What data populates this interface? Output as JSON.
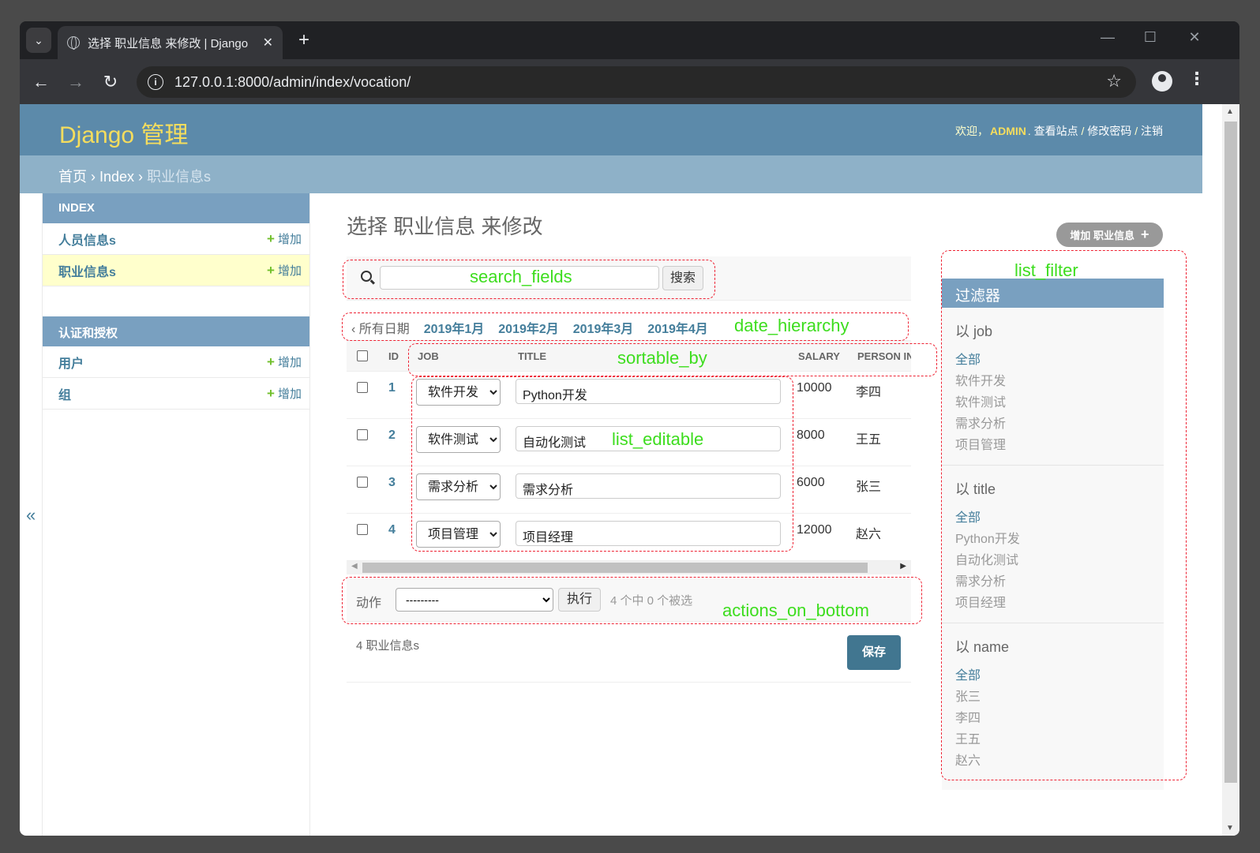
{
  "browser": {
    "tab_title": "选择 职业信息 来修改 | Django",
    "url": "127.0.0.1:8000/admin/index/vocation/"
  },
  "header": {
    "brand": "Django 管理",
    "welcome": "欢迎，",
    "username": "ADMIN",
    "view_site": "查看站点",
    "change_password": "修改密码",
    "logout": "注销"
  },
  "breadcrumbs": {
    "home": "首页",
    "app": "Index",
    "current": "职业信息s"
  },
  "sidebar": {
    "collapse_label": "«",
    "modules": [
      {
        "caption": "INDEX",
        "items": [
          {
            "name": "人员信息s",
            "add": "增加",
            "selected": false
          },
          {
            "name": "职业信息s",
            "add": "增加",
            "selected": true
          }
        ]
      },
      {
        "caption": "认证和授权",
        "items": [
          {
            "name": "用户",
            "add": "增加",
            "selected": false
          },
          {
            "name": "组",
            "add": "增加",
            "selected": false
          }
        ]
      }
    ]
  },
  "main": {
    "title": "选择 职业信息 来修改",
    "add_button": "增加 职业信息",
    "search": {
      "button": "搜索",
      "value": ""
    },
    "date_hierarchy": {
      "all": "‹ 所有日期",
      "dates": [
        "2019年1月",
        "2019年2月",
        "2019年3月",
        "2019年4月"
      ]
    },
    "table": {
      "headers": [
        "ID",
        "JOB",
        "TITLE",
        "SALARY",
        "PERSON IN"
      ],
      "rows": [
        {
          "id": "1",
          "job": "软件开发",
          "title": "Python开发",
          "salary": "10000",
          "person": "李四"
        },
        {
          "id": "2",
          "job": "软件测试",
          "title": "自动化测试",
          "salary": "8000",
          "person": "王五"
        },
        {
          "id": "3",
          "job": "需求分析",
          "title": "需求分析",
          "salary": "6000",
          "person": "张三"
        },
        {
          "id": "4",
          "job": "项目管理",
          "title": "项目经理",
          "salary": "12000",
          "person": "赵六"
        }
      ]
    },
    "actions": {
      "label": "动作",
      "select": "---------",
      "go": "执行",
      "counter": "4 个中 0 个被选"
    },
    "result_count": "4 职业信息s",
    "save": "保存"
  },
  "filter": {
    "caption": "过滤器",
    "sections": [
      {
        "title": "以 job",
        "options": [
          "全部",
          "软件开发",
          "软件测试",
          "需求分析",
          "项目管理"
        ]
      },
      {
        "title": "以 title",
        "options": [
          "全部",
          "Python开发",
          "自动化测试",
          "需求分析",
          "项目经理"
        ]
      },
      {
        "title": "以 name",
        "options": [
          "全部",
          "张三",
          "李四",
          "王五",
          "赵六"
        ]
      }
    ]
  },
  "annotations": {
    "search_fields": "search_fields",
    "date_hierarchy": "date_hierarchy",
    "sortable_by": "sortable_by",
    "list_editable": "list_editable",
    "actions_on_bottom": "actions_on_bottom",
    "list_filter": "list_filter"
  },
  "colors": {
    "header": "#5c8aaa",
    "brand": "#f5dd5d",
    "link": "#447e9b",
    "annotation": "#3ddd1e",
    "annotation_border": "#e23"
  }
}
